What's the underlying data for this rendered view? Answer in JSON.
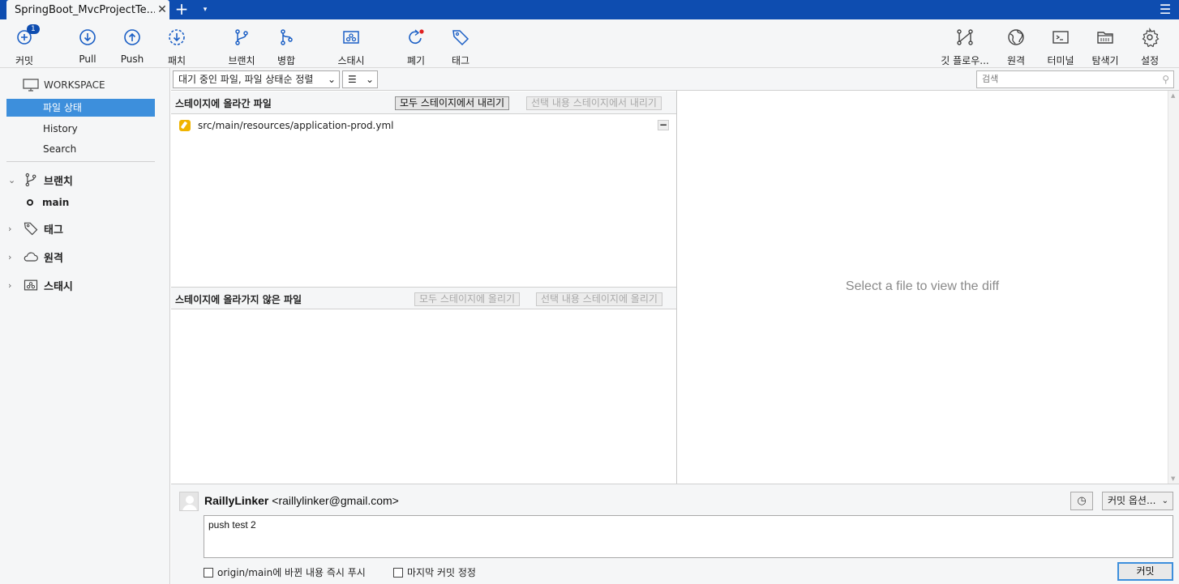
{
  "titlebar": {
    "tab_title": "SpringBoot_MvcProjectTe...",
    "close_glyph": "✕",
    "new_tab_glyph": "+",
    "dropdown_glyph": "▾",
    "menu_glyph": "☰"
  },
  "toolbar": {
    "commit": {
      "label": "커밋",
      "badge": "1"
    },
    "pull": "Pull",
    "push": "Push",
    "fetch": "패치",
    "branch": "브랜치",
    "merge": "병합",
    "stash": "스태시",
    "discard": "폐기",
    "tag": "태그",
    "gitflow": "깃 플로우...",
    "remote": "원격",
    "terminal": "터미널",
    "explorer": "탐색기",
    "settings": "설정"
  },
  "sidebar": {
    "workspace": "WORKSPACE",
    "items": [
      "파일 상태",
      "History",
      "Search"
    ],
    "branches": {
      "label": "브랜치",
      "items": [
        "main"
      ]
    },
    "tags": "태그",
    "remotes": "원격",
    "stashes": "스태시"
  },
  "filterbar": {
    "view_select": "대기 중인 파일, 파일 상태순 정렬",
    "list_mode_glyph": "☰",
    "search_placeholder": "검색"
  },
  "staged": {
    "title": "스테이지에 올라간 파일",
    "unstage_all": "모두 스테이지에서 내리기",
    "unstage_selected": "선택 내용 스테이지에서 내리기",
    "files": [
      "src/main/resources/application-prod.yml"
    ]
  },
  "unstaged": {
    "title": "스테이지에 올라가지 않은 파일",
    "stage_all": "모두 스테이지에 올리기",
    "stage_selected": "선택 내용 스테이지에 올리기"
  },
  "diff": {
    "placeholder": "Select a file to view the diff"
  },
  "commit": {
    "author_name": "RaillyLinker",
    "author_email": "<raillylinker@gmail.com>",
    "options_label": "커밋 옵션...",
    "message": "push test 2",
    "push_option": "origin/main에 바뀐 내용 즉시 푸시",
    "amend_option": "마지막 커밋 정정",
    "commit_button": "커밋"
  },
  "colors": {
    "accent": "#0e4db0",
    "selection": "#3d8fdc",
    "modified_badge": "#f0b400",
    "discard_dot": "#e02020"
  }
}
